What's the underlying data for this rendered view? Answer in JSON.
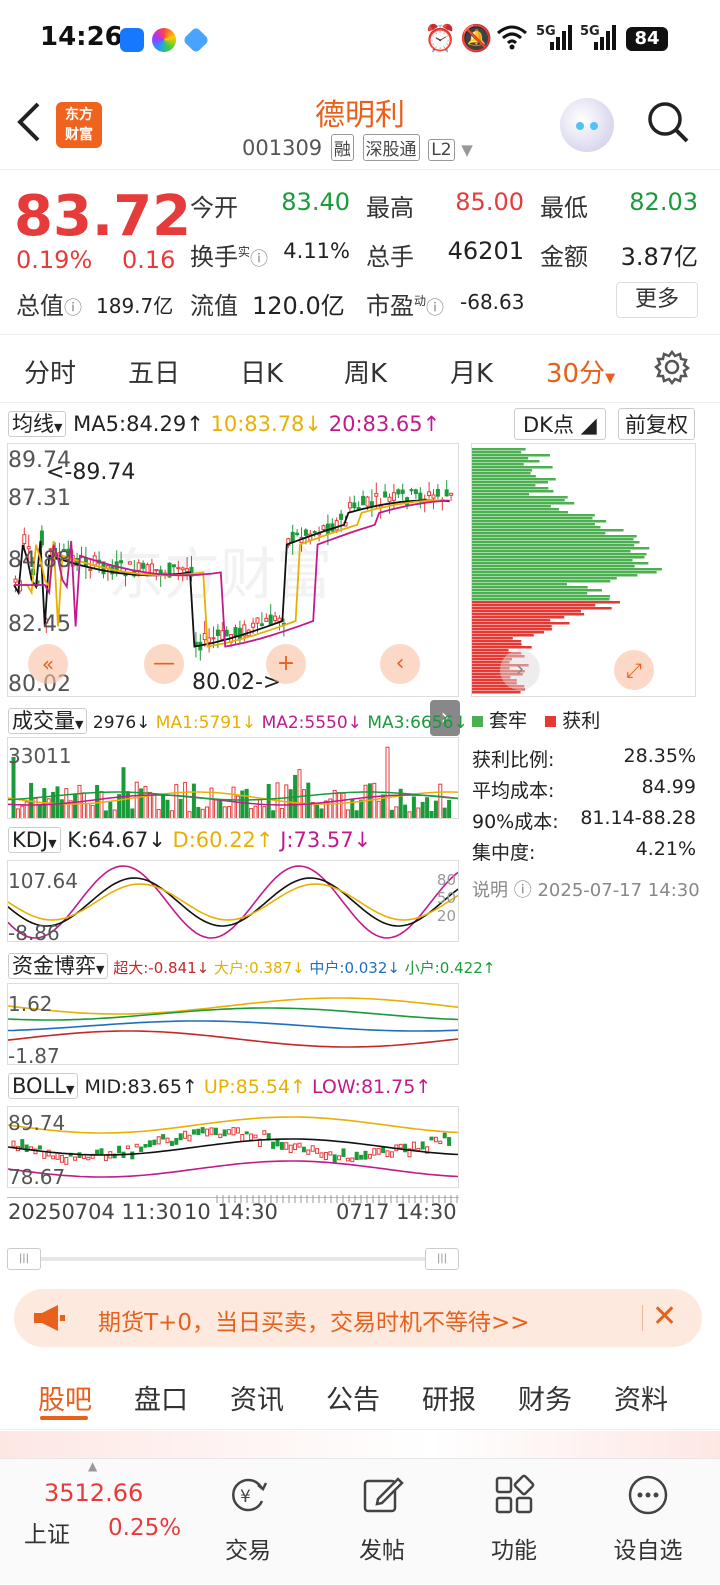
{
  "status": {
    "time": "14:26",
    "battery": "84",
    "net1": "5G",
    "net2": "5G"
  },
  "header": {
    "name": "德明利",
    "code": "001309",
    "tags": [
      "融",
      "深股通",
      "L2"
    ],
    "logo_line1": "东方",
    "logo_line2": "财富"
  },
  "quote": {
    "price": "83.72",
    "pct": "0.19%",
    "change": "0.16",
    "rows": [
      [
        {
          "label": "今开",
          "value": "83.40",
          "color": "green"
        },
        {
          "label": "最高",
          "value": "85.00",
          "color": "red"
        },
        {
          "label": "最低",
          "value": "82.03",
          "color": "green"
        }
      ],
      [
        {
          "label": "换手",
          "value": "4.11%",
          "color": "plain",
          "sup": "实"
        },
        {
          "label": "总手",
          "value": "46201",
          "color": "plain"
        },
        {
          "label": "金额",
          "value": "3.87亿",
          "color": "plain"
        }
      ],
      [
        {
          "label": "总值",
          "value": "189.7亿",
          "color": "plain"
        },
        {
          "label": "流值",
          "value": "120.0亿",
          "color": "plain"
        },
        {
          "label": "市盈",
          "value": "-68.63",
          "color": "plain",
          "sup": "动"
        }
      ]
    ],
    "more": "更多"
  },
  "tabs": {
    "items": [
      "分时",
      "五日",
      "日K",
      "周K",
      "月K",
      "30分"
    ],
    "active": 5
  },
  "chart": {
    "ma_label": "均线",
    "ma5": "MA5:84.29",
    "ma10": "10:83.78",
    "ma20": "20:83.65",
    "dk_label": "DK点",
    "fq_label": "前复权",
    "price_ticks": [
      "89.74",
      "87.31",
      "84.88",
      "82.45",
      "80.02"
    ],
    "max_note": "<-89.74",
    "min_note": "80.02->",
    "watermark": "东方财富",
    "vol_label": "成交量",
    "vol_vals": [
      "2976",
      "MA1:5791",
      "MA2:5550",
      "MA3:6656"
    ],
    "vol_tick": "33011",
    "kdj_label": "KDJ",
    "kdj_k": "K:64.67",
    "kdj_d": "D:60.22",
    "kdj_j": "J:73.57",
    "kdj_ticks": [
      "107.64",
      "-8.86"
    ],
    "kdj_right": [
      "80",
      "50",
      "20"
    ],
    "fund_label": "资金博弈",
    "fund_vals": [
      "超大:-0.841",
      "大户:0.387",
      "中户:0.032",
      "小户:0.422"
    ],
    "fund_ticks": [
      "1.62",
      "-1.87"
    ],
    "boll_label": "BOLL",
    "boll_mid": "MID:83.65",
    "boll_up": "UP:85.54",
    "boll_low": "LOW:81.75",
    "boll_ticks": [
      "89.74",
      "78.67"
    ],
    "time_axis": [
      "20250704 11:30",
      "10 14:30",
      "0717 14:30"
    ]
  },
  "chip": {
    "legend_trap": "套牢",
    "legend_profit": "获利",
    "rows": [
      {
        "label": "获利比例:",
        "value": "28.35%"
      },
      {
        "label": "平均成本:",
        "value": "84.99"
      },
      {
        "label": "90%成本:",
        "value": "81.14-88.28"
      },
      {
        "label": "集中度:",
        "value": "4.21%"
      }
    ],
    "note": "说明",
    "note_time": "2025-07-17 14:30"
  },
  "promo": {
    "text": "期货T+0，当日买卖，交易时机不等待>>"
  },
  "f10": {
    "items": [
      "股吧",
      "盘口",
      "资讯",
      "公告",
      "研报",
      "财务",
      "资料"
    ],
    "active": 0
  },
  "bottom": {
    "index_value": "3512.66",
    "index_name": "上证",
    "index_pct": "0.25%",
    "items": [
      "交易",
      "发帖",
      "功能",
      "设自选"
    ]
  },
  "colors": {
    "accent": "#e8601c",
    "up": "#e63b3b",
    "down": "#1a9b3a"
  }
}
